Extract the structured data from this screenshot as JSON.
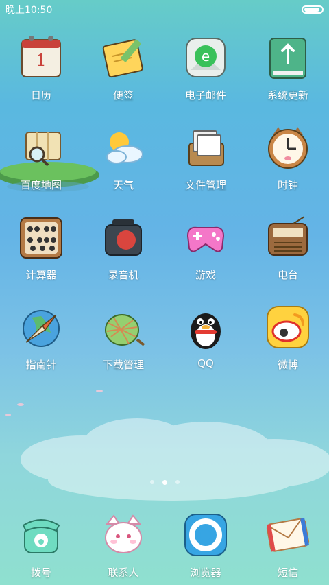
{
  "status_bar": {
    "time": "晚上10:50"
  },
  "apps": [
    {
      "label": "日历",
      "icon": "calendar-icon"
    },
    {
      "label": "便签",
      "icon": "sticky-note-icon"
    },
    {
      "label": "电子邮件",
      "icon": "email-icon"
    },
    {
      "label": "系统更新",
      "icon": "system-update-icon"
    },
    {
      "label": "百度地图",
      "icon": "map-icon"
    },
    {
      "label": "天气",
      "icon": "weather-icon"
    },
    {
      "label": "文件管理",
      "icon": "file-manager-icon"
    },
    {
      "label": "时钟",
      "icon": "clock-icon"
    },
    {
      "label": "计算器",
      "icon": "abacus-calculator-icon"
    },
    {
      "label": "录音机",
      "icon": "recorder-icon"
    },
    {
      "label": "游戏",
      "icon": "gamepad-icon"
    },
    {
      "label": "电台",
      "icon": "radio-icon"
    },
    {
      "label": "指南针",
      "icon": "compass-icon"
    },
    {
      "label": "下载管理",
      "icon": "download-net-icon"
    },
    {
      "label": "QQ",
      "icon": "qq-penguin-icon"
    },
    {
      "label": "微博",
      "icon": "weibo-icon"
    }
  ],
  "page_indicator": {
    "pages": 3,
    "current": 2
  },
  "dock": [
    {
      "label": "拨号",
      "icon": "phone-icon"
    },
    {
      "label": "联系人",
      "icon": "contacts-cat-icon"
    },
    {
      "label": "浏览器",
      "icon": "browser-icon"
    },
    {
      "label": "短信",
      "icon": "envelope-icon"
    }
  ]
}
